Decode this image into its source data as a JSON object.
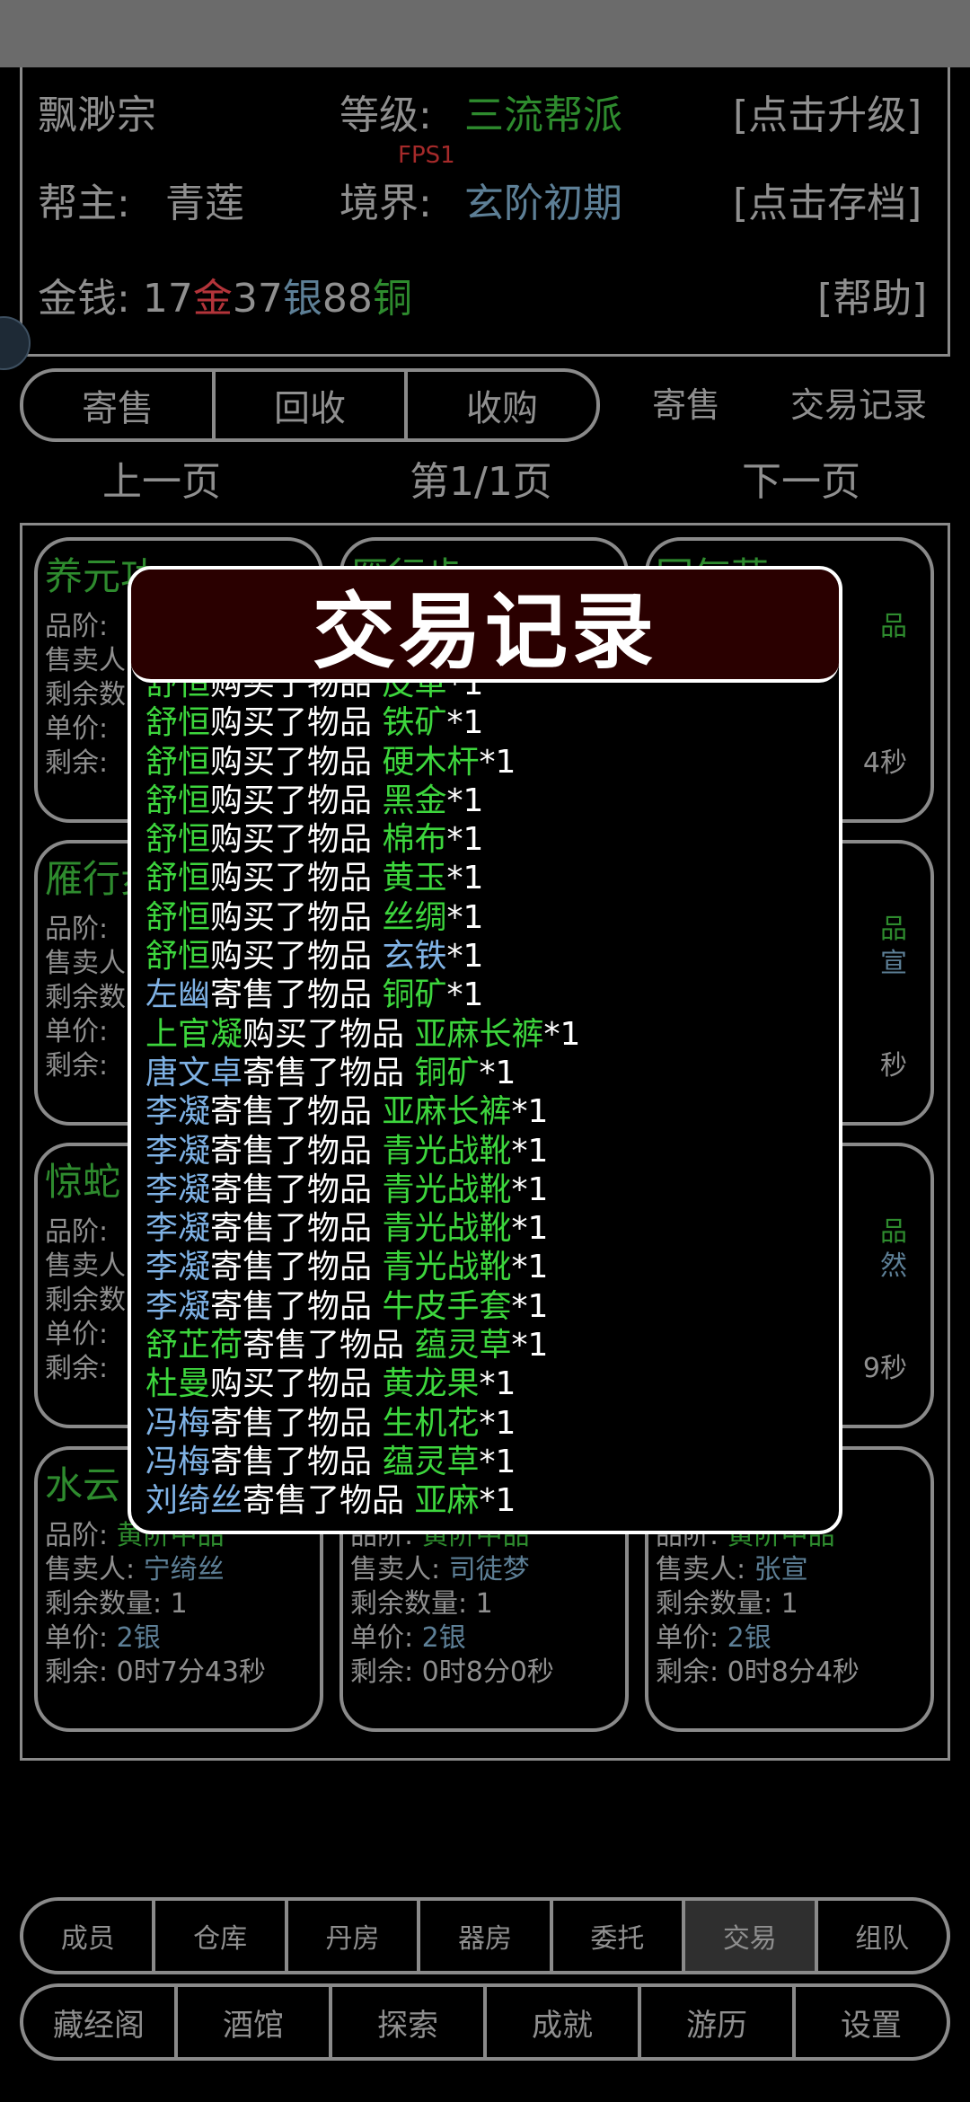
{
  "sect": {
    "name": "飘渺宗",
    "level_label": "等级:",
    "level_value": "三流帮派",
    "upgrade": "[点击升级]",
    "leader_label": "帮主:",
    "leader_value": "青莲",
    "realm_label": "境界:",
    "realm_value": "玄阶初期",
    "save": "[点击存档]",
    "money_label": "金钱:",
    "money_gold": "17",
    "money_gold_unit": "金",
    "money_silver": "37",
    "money_silver_unit": "银",
    "money_copper": "88",
    "money_copper_unit": "铜",
    "help": "[帮助]",
    "fps": "FPS1"
  },
  "tabs": {
    "segmented": [
      "寄售",
      "回收",
      "收购"
    ],
    "consign": "寄售",
    "records": "交易记录"
  },
  "pager": {
    "prev": "上一页",
    "page": "第1/1页",
    "next": "下一页"
  },
  "cards": [
    {
      "name": "养元功",
      "rows": [
        {
          "k": "品阶:",
          "v": ""
        },
        {
          "k": "售卖人:",
          "v": ""
        },
        {
          "k": "剩余数",
          "v": ""
        },
        {
          "k": "单价:",
          "v": ""
        },
        {
          "k": "剩余:",
          "v": ""
        }
      ]
    },
    {
      "name": "雁行步",
      "rows": []
    },
    {
      "name": "回气草",
      "rows": [
        {
          "k": "",
          "v": "品"
        },
        {
          "k": "",
          "v": ""
        },
        {
          "k": "",
          "v": ""
        },
        {
          "k": "",
          "v": ""
        },
        {
          "k": "",
          "v": "4秒"
        }
      ]
    },
    {
      "name": "雁行步",
      "rows": [
        {
          "k": "品阶:",
          "v": ""
        },
        {
          "k": "售卖人",
          "v": ""
        },
        {
          "k": "剩余数",
          "v": ""
        },
        {
          "k": "单价:",
          "v": ""
        },
        {
          "k": "剩余:",
          "v": ""
        }
      ]
    },
    {
      "name": "",
      "rows": []
    },
    {
      "name": "",
      "rows": [
        {
          "k": "",
          "v": "品"
        },
        {
          "k": "",
          "v": "宣"
        },
        {
          "k": "",
          "v": ""
        },
        {
          "k": "",
          "v": ""
        },
        {
          "k": "",
          "v": "秒"
        }
      ]
    },
    {
      "name": "惊蛇",
      "rows": [
        {
          "k": "品阶:",
          "v": ""
        },
        {
          "k": "售卖人",
          "v": ""
        },
        {
          "k": "剩余数",
          "v": ""
        },
        {
          "k": "单价:",
          "v": ""
        },
        {
          "k": "剩余:",
          "v": ""
        }
      ]
    },
    {
      "name": "",
      "rows": []
    },
    {
      "name": "",
      "rows": [
        {
          "k": "",
          "v": "品"
        },
        {
          "k": "",
          "v": "然"
        },
        {
          "k": "",
          "v": ""
        },
        {
          "k": "",
          "v": ""
        },
        {
          "k": "",
          "v": "9秒"
        }
      ]
    },
    {
      "name": "水云",
      "rows": [
        {
          "k": "品阶:",
          "v": "黄阶中品"
        },
        {
          "k": "售卖人:",
          "v": "宁绮丝"
        },
        {
          "k": "剩余数量:",
          "v": "1"
        },
        {
          "k": "单价:",
          "v": "2银"
        },
        {
          "k": "剩余:",
          "v": "0时7分43秒"
        }
      ]
    },
    {
      "name": "",
      "rows": [
        {
          "k": "品阶:",
          "v": "黄阶中品"
        },
        {
          "k": "售卖人:",
          "v": "司徒梦"
        },
        {
          "k": "剩余数量:",
          "v": "1"
        },
        {
          "k": "单价:",
          "v": "2银"
        },
        {
          "k": "剩余:",
          "v": "0时8分0秒"
        }
      ]
    },
    {
      "name": "",
      "rows": [
        {
          "k": "品阶:",
          "v": "黄阶中品"
        },
        {
          "k": "售卖人:",
          "v": "张宣"
        },
        {
          "k": "剩余数量:",
          "v": "1"
        },
        {
          "k": "单价:",
          "v": "2银"
        },
        {
          "k": "剩余:",
          "v": "0时8分4秒"
        }
      ]
    }
  ],
  "nav_primary": [
    "成员",
    "仓库",
    "丹房",
    "器房",
    "委托",
    "交易",
    "组队"
  ],
  "nav_primary_active": "交易",
  "nav_secondary": [
    "藏经阁",
    "酒馆",
    "探索",
    "成就",
    "游历",
    "设置"
  ],
  "modal": {
    "title": "交易记录",
    "records": [
      {
        "who": "舒恒",
        "who_color": "green",
        "action": "购买了物品 ",
        "item": "皮革",
        "qty": "*1"
      },
      {
        "who": "舒恒",
        "who_color": "green",
        "action": "购买了物品 ",
        "item": "铁矿",
        "qty": "*1"
      },
      {
        "who": "舒恒",
        "who_color": "green",
        "action": "购买了物品 ",
        "item": "硬木杆",
        "qty": "*1"
      },
      {
        "who": "舒恒",
        "who_color": "green",
        "action": "购买了物品 ",
        "item": "黑金",
        "qty": "*1"
      },
      {
        "who": "舒恒",
        "who_color": "green",
        "action": "购买了物品 ",
        "item": "棉布",
        "qty": "*1"
      },
      {
        "who": "舒恒",
        "who_color": "green",
        "action": "购买了物品 ",
        "item": "黄玉",
        "qty": "*1"
      },
      {
        "who": "舒恒",
        "who_color": "green",
        "action": "购买了物品 ",
        "item": "丝绸",
        "qty": "*1"
      },
      {
        "who": "舒恒",
        "who_color": "green",
        "action": "购买了物品 ",
        "item": "玄铁",
        "qty": "*1",
        "item_color": "blue"
      },
      {
        "who": "左幽",
        "who_color": "blue",
        "action": "寄售了物品 ",
        "item": "铜矿",
        "qty": "*1"
      },
      {
        "who": "上官凝",
        "who_color": "green",
        "action": "购买了物品 ",
        "item": "亚麻长裤",
        "qty": "*1"
      },
      {
        "who": "唐文卓",
        "who_color": "blue",
        "action": "寄售了物品 ",
        "item": "铜矿",
        "qty": "*1"
      },
      {
        "who": "李凝",
        "who_color": "blue",
        "action": "寄售了物品 ",
        "item": "亚麻长裤",
        "qty": "*1"
      },
      {
        "who": "李凝",
        "who_color": "blue",
        "action": "寄售了物品 ",
        "item": "青光战靴",
        "qty": "*1"
      },
      {
        "who": "李凝",
        "who_color": "blue",
        "action": "寄售了物品 ",
        "item": "青光战靴",
        "qty": "*1"
      },
      {
        "who": "李凝",
        "who_color": "blue",
        "action": "寄售了物品 ",
        "item": "青光战靴",
        "qty": "*1"
      },
      {
        "who": "李凝",
        "who_color": "blue",
        "action": "寄售了物品 ",
        "item": "青光战靴",
        "qty": "*1"
      },
      {
        "who": "李凝",
        "who_color": "blue",
        "action": "寄售了物品 ",
        "item": "牛皮手套",
        "qty": "*1"
      },
      {
        "who": "舒芷荷",
        "who_color": "green",
        "action": "寄售了物品 ",
        "item": "蕴灵草",
        "qty": "*1"
      },
      {
        "who": "杜曼",
        "who_color": "green",
        "action": "购买了物品 ",
        "item": "黄龙果",
        "qty": "*1"
      },
      {
        "who": "冯梅",
        "who_color": "blue",
        "action": "寄售了物品 ",
        "item": "生机花",
        "qty": "*1"
      },
      {
        "who": "冯梅",
        "who_color": "blue",
        "action": "寄售了物品 ",
        "item": "蕴灵草",
        "qty": "*1"
      },
      {
        "who": "刘绮丝",
        "who_color": "blue",
        "action": "寄售了物品 ",
        "item": "亚麻",
        "qty": "*1"
      }
    ]
  },
  "colors": {
    "accent_green": "#3dd63d",
    "name_blue": "#7fb2e5",
    "modal_header_bg": "#2a0000",
    "dim_green": "#2e8b2e",
    "dim_steel": "#5d7f96"
  }
}
